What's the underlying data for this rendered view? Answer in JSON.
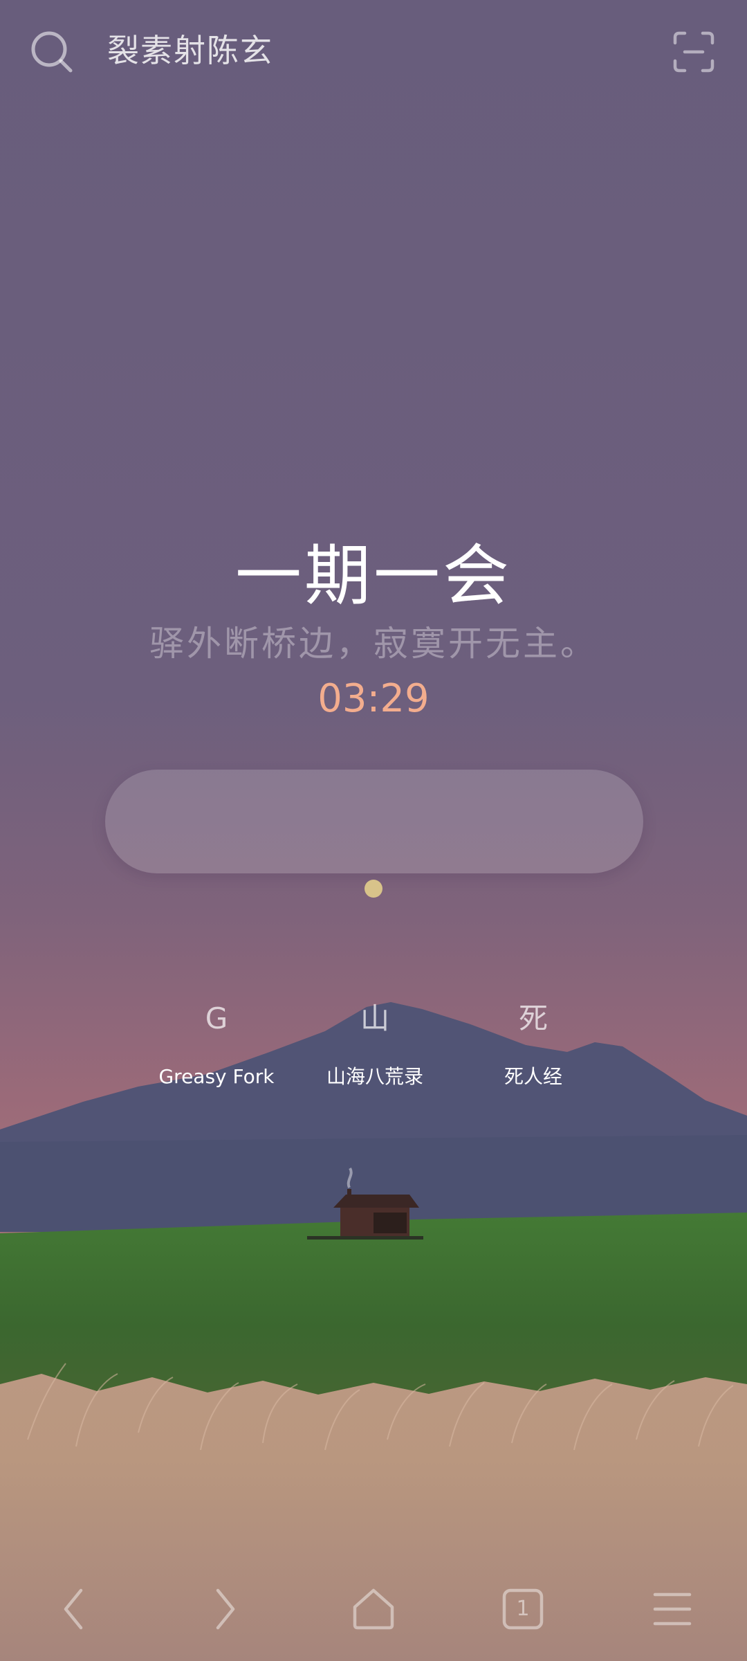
{
  "top_bar": {
    "search_icon": "search-icon",
    "search_text": "裂素射陈玄",
    "scan_icon": "scan-icon"
  },
  "hero": {
    "title": "一期一会",
    "subtitle": "驿外断桥边，寂寞开无主。",
    "time": "03:29"
  },
  "shortcuts": [
    {
      "initial": "G",
      "label": "Greasy Fork"
    },
    {
      "initial": "山",
      "label": "山海八荒录"
    },
    {
      "initial": "死",
      "label": "死人经"
    }
  ],
  "bottom_bar": {
    "back_icon": "chevron-left-icon",
    "forward_icon": "chevron-right-icon",
    "home_icon": "home-icon",
    "tabs_count": "1",
    "menu_icon": "menu-icon"
  },
  "colors": {
    "sky_top": "#685d7c",
    "sky_horizon": "#9c6a7a",
    "mountain": "#4c5171",
    "field": "#3e6b31",
    "grass": "#b48f80",
    "clock": "#f3ad8e"
  }
}
